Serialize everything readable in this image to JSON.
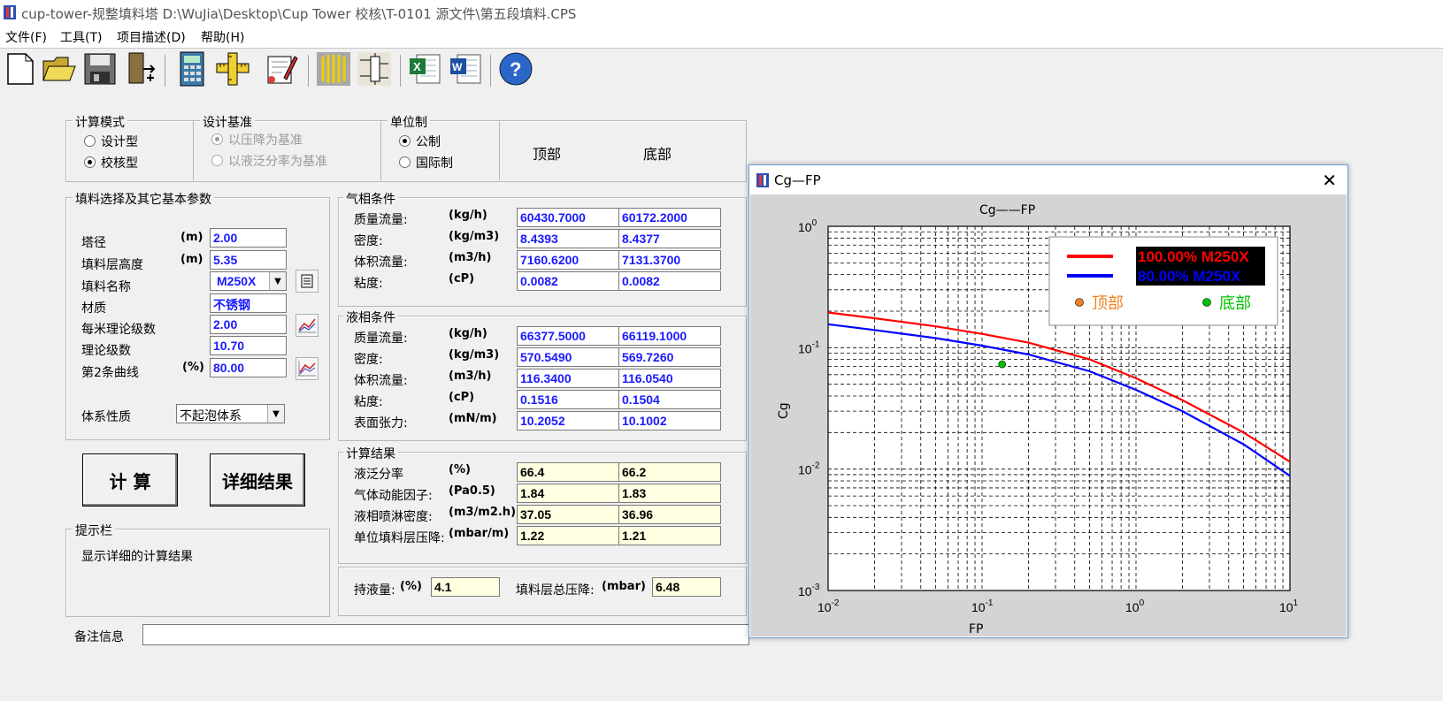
{
  "window": {
    "title": "cup-tower-规整填料塔    D:\\WuJia\\Desktop\\Cup Tower 校核\\T-0101 源文件\\第五段填料.CPS"
  },
  "menu": [
    "文件(F)",
    "工具(T)",
    "项目描述(D)",
    "帮助(H)"
  ],
  "toolbar": [
    "new-file-icon",
    "open-folder-icon",
    "save-icon",
    "exit-icon",
    "calculator-icon",
    "ruler-icon",
    "edit-icon",
    "packing-icon",
    "tower-icon",
    "excel-icon",
    "word-icon",
    "help-icon"
  ],
  "calc_mode": {
    "title": "计算模式",
    "design": "设计型",
    "check": "校核型",
    "selected": "check"
  },
  "design_basis": {
    "title": "设计基准",
    "pressure": "以压降为基准",
    "flood": "以液泛分率为基准"
  },
  "unit_system": {
    "title": "单位制",
    "metric": "公制",
    "intl": "国际制"
  },
  "col_headers": {
    "top": "顶部",
    "bottom": "底部"
  },
  "packing": {
    "title": "填料选择及其它基本参数",
    "rows": [
      {
        "label": "塔径",
        "unit": "(m)",
        "value": "2.00"
      },
      {
        "label": "填料层高度",
        "unit": "(m)",
        "value": "5.35"
      },
      {
        "label": "填料名称",
        "unit": "",
        "value": "M250X"
      },
      {
        "label": "材质",
        "unit": "",
        "value": "不锈钢"
      },
      {
        "label": "每米理论级数",
        "unit": "",
        "value": "2.00"
      },
      {
        "label": "理论级数",
        "unit": "",
        "value": "10.70"
      },
      {
        "label": "第2条曲线",
        "unit": "(%)",
        "value": "80.00"
      }
    ],
    "system_label": "体系性质",
    "system_value": "不起泡体系"
  },
  "gas": {
    "title": "气相条件",
    "rows": [
      {
        "label": "质量流量:",
        "unit": "(kg/h)",
        "top": "60430.7000",
        "bottom": "60172.2000"
      },
      {
        "label": "密度:",
        "unit": "(kg/m3)",
        "top": "8.4393",
        "bottom": "8.4377"
      },
      {
        "label": "体积流量:",
        "unit": "(m3/h)",
        "top": "7160.6200",
        "bottom": "7131.3700"
      },
      {
        "label": "粘度:",
        "unit": "(cP)",
        "top": "0.0082",
        "bottom": "0.0082"
      }
    ]
  },
  "liquid": {
    "title": "液相条件",
    "rows": [
      {
        "label": "质量流量:",
        "unit": "(kg/h)",
        "top": "66377.5000",
        "bottom": "66119.1000"
      },
      {
        "label": "密度:",
        "unit": "(kg/m3)",
        "top": "570.5490",
        "bottom": "569.7260"
      },
      {
        "label": "体积流量:",
        "unit": "(m3/h)",
        "top": "116.3400",
        "bottom": "116.0540"
      },
      {
        "label": "粘度:",
        "unit": "(cP)",
        "top": "0.1516",
        "bottom": "0.1504"
      },
      {
        "label": "表面张力:",
        "unit": "(mN/m)",
        "top": "10.2052",
        "bottom": "10.1002"
      }
    ]
  },
  "results": {
    "title": "计算结果",
    "rows": [
      {
        "label": "液泛分率",
        "unit": "(%)",
        "top": "66.4",
        "bottom": "66.2"
      },
      {
        "label": "气体动能因子:",
        "unit": "(Pa0.5)",
        "top": "1.84",
        "bottom": "1.83"
      },
      {
        "label": "液相喷淋密度:",
        "unit": "(m3/m2.h)",
        "top": "37.05",
        "bottom": "36.96"
      },
      {
        "label": "单位填料层压降:",
        "unit": "(mbar/m)",
        "top": "1.22",
        "bottom": "1.21"
      }
    ]
  },
  "holdup": {
    "label": "持液量:",
    "unit": "(%)",
    "value": "4.1"
  },
  "total_dp": {
    "label": "填料层总压降:",
    "unit": "(mbar)",
    "value": "6.48"
  },
  "buttons": {
    "calc": "计 算",
    "detail": "详细结果"
  },
  "hint": {
    "title": "提示栏",
    "text": "显示详细的计算结果"
  },
  "notes": {
    "label": "备注信息",
    "value": ""
  },
  "chart_window": {
    "title": "Cg—FP",
    "close": "✕"
  },
  "chart_data": {
    "type": "line",
    "title": "Cg——FP",
    "xlabel": "FP",
    "ylabel": "Cg",
    "xscale": "log",
    "yscale": "log",
    "xlim": [
      0.01,
      10
    ],
    "ylim": [
      0.001,
      1
    ],
    "x_ticks": [
      {
        "base": "10",
        "exp": "-2"
      },
      {
        "base": "10",
        "exp": "-1"
      },
      {
        "base": "10",
        "exp": "0"
      },
      {
        "base": "10",
        "exp": "1"
      }
    ],
    "y_ticks": [
      {
        "base": "10",
        "exp": "0"
      },
      {
        "base": "10",
        "exp": "-1"
      },
      {
        "base": "10",
        "exp": "-2"
      },
      {
        "base": "10",
        "exp": "-3"
      }
    ],
    "grid": true,
    "legend_position": "top-right",
    "series": [
      {
        "name": "100.00% M250X",
        "color": "#ff0000",
        "x": [
          0.01,
          0.02,
          0.05,
          0.1,
          0.2,
          0.5,
          1,
          2,
          5,
          10
        ],
        "y": [
          0.195,
          0.175,
          0.15,
          0.13,
          0.11,
          0.08,
          0.056,
          0.037,
          0.02,
          0.0115
        ]
      },
      {
        "name": "80.00% M250X",
        "color": "#0000ff",
        "x": [
          0.01,
          0.02,
          0.05,
          0.1,
          0.2,
          0.5,
          1,
          2,
          5,
          10
        ],
        "y": [
          0.156,
          0.14,
          0.12,
          0.104,
          0.088,
          0.064,
          0.045,
          0.03,
          0.016,
          0.0088
        ]
      }
    ],
    "points": [
      {
        "name": "顶部",
        "color": "#f08020",
        "x": null,
        "y": null
      },
      {
        "name": "底部",
        "color": "#00c000",
        "x": 0.135,
        "y": 0.073
      }
    ]
  }
}
